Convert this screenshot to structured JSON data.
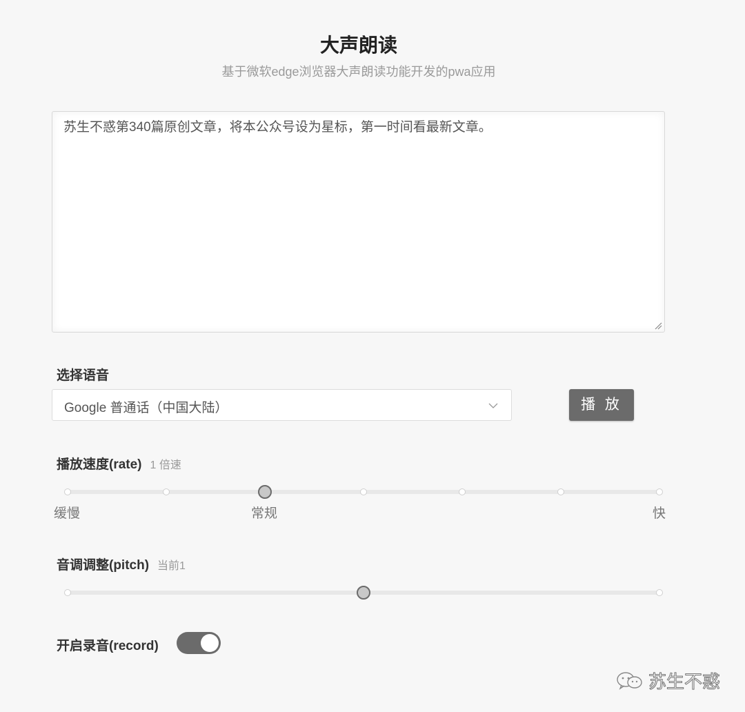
{
  "header": {
    "title": "大声朗读",
    "subtitle": "基于微软edge浏览器大声朗读功能开发的pwa应用"
  },
  "editor": {
    "text": "苏生不惑第340篇原创文章，将本公众号设为星标，第一时间看最新文章。"
  },
  "voice": {
    "label": "选择语音",
    "selected": "Google 普通话（中国大陆）",
    "play_label": "播 放"
  },
  "rate": {
    "label": "播放速度(rate)",
    "hint": "1 倍速",
    "marks": [
      "缓慢",
      "常规",
      "快"
    ],
    "steps": 7,
    "current_step_index": 2
  },
  "pitch": {
    "label": "音调调整(pitch)",
    "hint": "当前1",
    "level_fraction": 0.5
  },
  "record": {
    "label": "开启录音(record)",
    "enabled": true
  },
  "watermark": {
    "text": "苏生不惑",
    "icon": "wechat-icon"
  },
  "colors": {
    "accent": "#6b6b6b",
    "background": "#f7f7f7",
    "track": "#e8e8e8"
  }
}
